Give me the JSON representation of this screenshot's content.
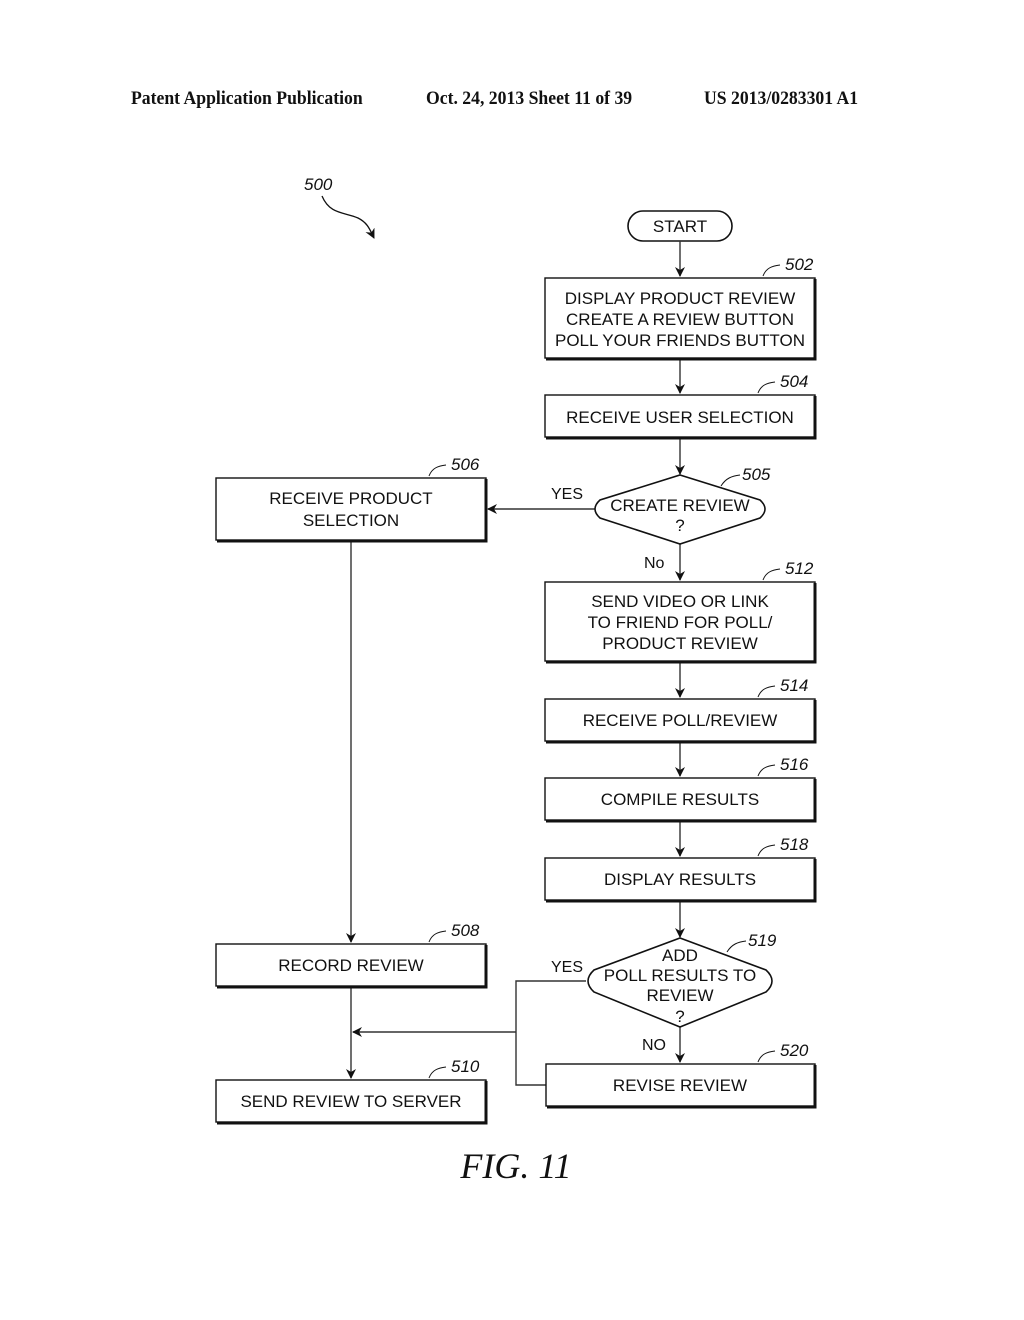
{
  "header": {
    "publication": "Patent Application Publication",
    "date_sheet": "Oct. 24, 2013   Sheet 11 of 39",
    "patent_number": "US 2013/0283301 A1"
  },
  "diagram": {
    "ref": "500",
    "start": "START",
    "nodes": {
      "n502": {
        "ref": "502",
        "lines": [
          "DISPLAY PRODUCT REVIEW",
          "CREATE A REVIEW BUTTON",
          "POLL YOUR FRIENDS BUTTON"
        ]
      },
      "n504": {
        "ref": "504",
        "lines": [
          "RECEIVE USER SELECTION"
        ]
      },
      "n505": {
        "ref": "505",
        "lines": [
          "CREATE REVIEW",
          "?"
        ]
      },
      "n506": {
        "ref": "506",
        "lines": [
          "RECEIVE PRODUCT",
          "SELECTION"
        ]
      },
      "n508": {
        "ref": "508",
        "lines": [
          "RECORD REVIEW"
        ]
      },
      "n510": {
        "ref": "510",
        "lines": [
          "SEND REVIEW TO SERVER"
        ]
      },
      "n512": {
        "ref": "512",
        "lines": [
          "SEND VIDEO OR LINK",
          "TO FRIEND FOR POLL/",
          "PRODUCT REVIEW"
        ]
      },
      "n514": {
        "ref": "514",
        "lines": [
          "RECEIVE POLL/REVIEW"
        ]
      },
      "n516": {
        "ref": "516",
        "lines": [
          "COMPILE RESULTS"
        ]
      },
      "n518": {
        "ref": "518",
        "lines": [
          "DISPLAY RESULTS"
        ]
      },
      "n519": {
        "ref": "519",
        "lines": [
          "ADD",
          "POLL RESULTS TO",
          "REVIEW",
          "?"
        ]
      },
      "n520": {
        "ref": "520",
        "lines": [
          "REVISE REVIEW"
        ]
      }
    },
    "edge_labels": {
      "yes_505": "YES",
      "no_505": "No",
      "yes_519": "YES",
      "no_519": "NO"
    },
    "figure_label": "FIG. 11"
  }
}
